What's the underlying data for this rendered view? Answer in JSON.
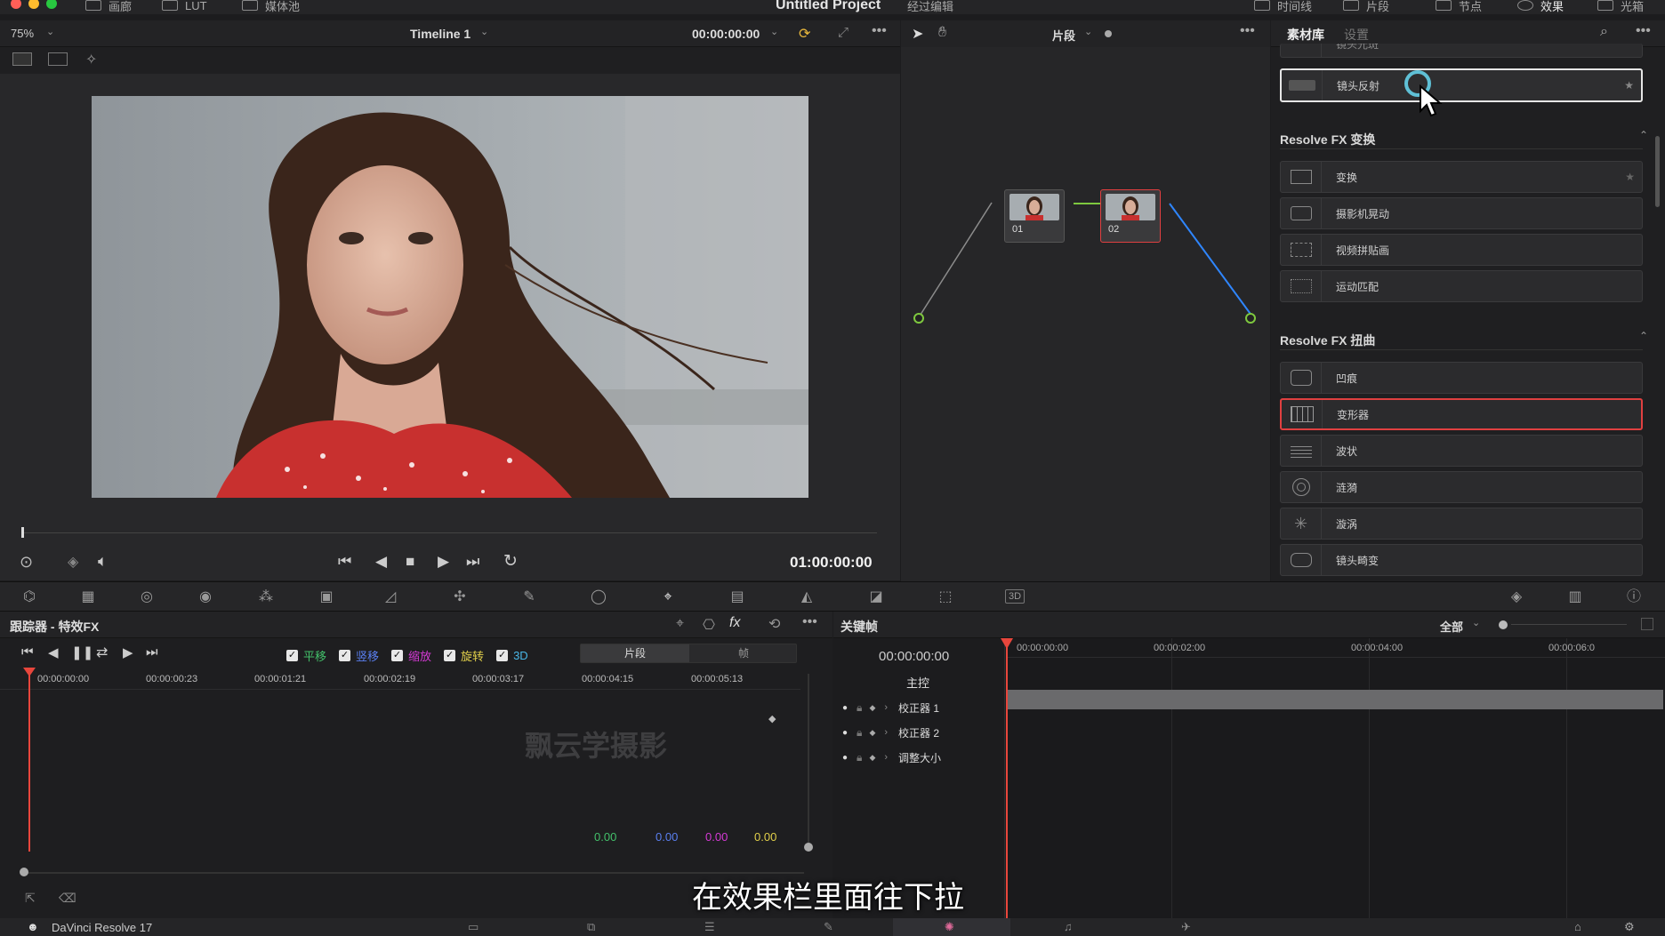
{
  "titlebar": {
    "project_title": "Untitled Project",
    "project_subtitle": "经过编辑",
    "left_items": [
      "画廊",
      "LUT",
      "媒体池"
    ],
    "right_items": [
      "时间线",
      "片段",
      "节点",
      "效果",
      "光箱"
    ]
  },
  "viewer": {
    "zoom": "75%",
    "timeline_name": "Timeline 1",
    "timecode_top": "00:00:00:00",
    "timecode_bottom": "01:00:00:00"
  },
  "node_editor": {
    "mode_label": "片段",
    "nodes": [
      "01",
      "02"
    ]
  },
  "fx_library": {
    "tabs": [
      "素材库",
      "设置"
    ],
    "top_partial_item": "镜头光斑",
    "highlighted_top": "镜头反射",
    "group_transform": {
      "title": "Resolve FX 变换",
      "items": [
        "变换",
        "摄影机晃动",
        "视频拼贴画",
        "运动匹配"
      ]
    },
    "group_warp": {
      "title": "Resolve FX 扭曲",
      "items": [
        "凹痕",
        "变形器",
        "波状",
        "涟漪",
        "漩涡",
        "镜头畸变"
      ]
    }
  },
  "tracker": {
    "title": "跟踪器 - 特效FX",
    "checks": [
      "平移",
      "竖移",
      "缩放",
      "旋转",
      "3D"
    ],
    "check_colors": [
      "#43c06a",
      "#5a7ff0",
      "#d63ad6",
      "#e2d04a",
      "#49b6e6"
    ],
    "mode_tabs": [
      "片段",
      "帧"
    ],
    "ruler": [
      "00:00:00:00",
      "00:00:00:23",
      "00:00:01:21",
      "00:00:02:19",
      "00:00:03:17",
      "00:00:04:15",
      "00:00:05:13"
    ],
    "values": [
      "0.00",
      "0.00",
      "0.00",
      "0.00"
    ],
    "watermark": "飘云学摄影"
  },
  "keyframes": {
    "title": "关键帧",
    "filter": "全部",
    "timecode": "00:00:00:00",
    "ruler": [
      "00:00:00:00",
      "00:00:02:00",
      "00:00:04:00",
      "00:00:06:0"
    ],
    "tracks": [
      "主控",
      "校正器 1",
      "校正器 2",
      "调整大小"
    ]
  },
  "subtitle": "在效果栏里面往下拉",
  "app_name": "DaVinci Resolve 17",
  "colors": {
    "accent_red": "#e04040",
    "playhead": "#e8463c",
    "link_blue": "#2f86ff"
  }
}
